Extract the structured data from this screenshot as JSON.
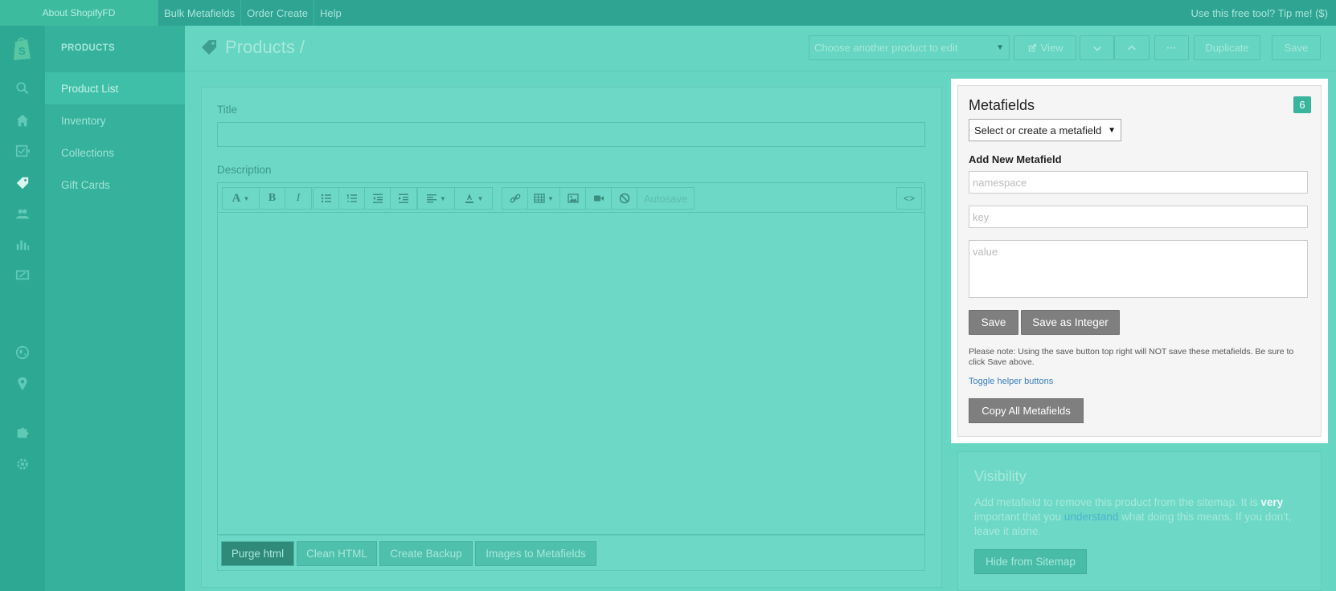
{
  "topbar": {
    "about": "About ShopifyFD",
    "links": [
      "Bulk Metafields",
      "Order Create",
      "Help"
    ],
    "right": "Use this free tool? Tip me! ($)"
  },
  "sidenav": {
    "heading": "PRODUCTS",
    "items": [
      {
        "label": "Product List",
        "active": true
      },
      {
        "label": "Inventory"
      },
      {
        "label": "Collections"
      },
      {
        "label": "Gift Cards"
      }
    ]
  },
  "header": {
    "title": "Products /",
    "product_select": "Choose another product to edit",
    "view": "View",
    "more": "···",
    "duplicate": "Duplicate",
    "save": "Save"
  },
  "form": {
    "title_label": "Title",
    "description_label": "Description",
    "autosave": "Autosave",
    "code_toggle": "<>",
    "bottom_buttons": [
      "Purge html",
      "Clean HTML",
      "Create Backup",
      "Images to Metafields"
    ]
  },
  "metafields": {
    "title": "Metafields",
    "count": "6",
    "select_placeholder": "Select or create a metafield",
    "add_heading": "Add New Metafield",
    "namespace_placeholder": "namespace",
    "key_placeholder": "key",
    "value_placeholder": "value",
    "save": "Save",
    "save_integer": "Save as Integer",
    "note": "Please note: Using the save button top right will NOT save these metafields. Be sure to click Save above.",
    "toggle_helper": "Toggle helper buttons",
    "copy_all": "Copy All Metafields"
  },
  "visibility": {
    "title": "Visibility",
    "text_a": "Add metafield to remove this product from the sitemap. It is ",
    "text_bold": "very",
    "text_b": " important that you ",
    "text_link": "understand",
    "text_c": " what doing this means. If you don't, leave it alone.",
    "button": "Hide from Sitemap"
  },
  "colors": {
    "accent": "#39b49d",
    "overlay": "#66d5c1",
    "link": "#3a7dbd"
  }
}
